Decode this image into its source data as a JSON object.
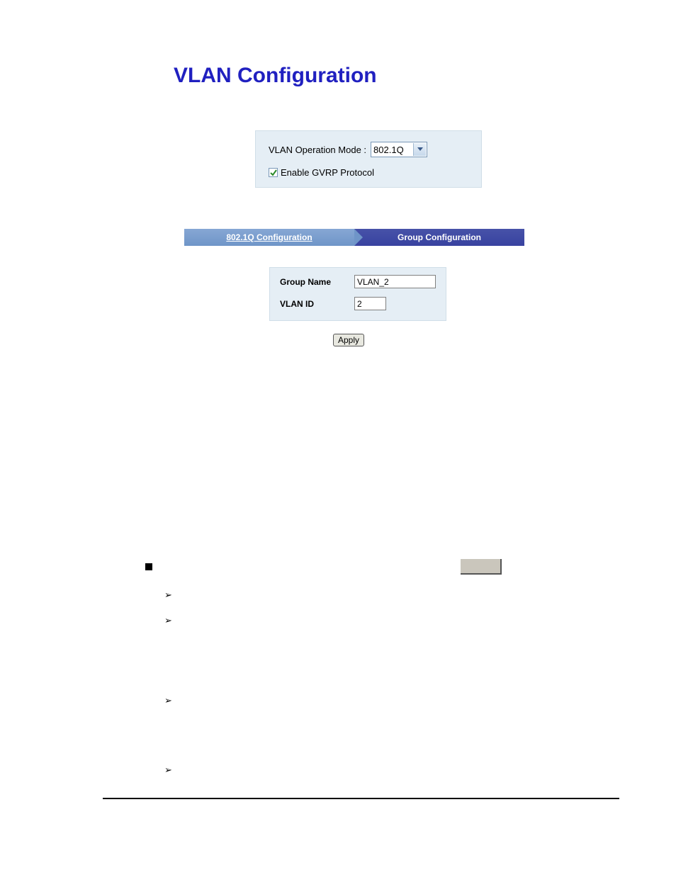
{
  "title": "VLAN Configuration",
  "mode_panel": {
    "label": "VLAN Operation Mode :",
    "selected": "802.1Q",
    "gvrp_label": "Enable GVRP Protocol",
    "gvrp_checked": true
  },
  "tabs": {
    "active": "802.1Q Configuration",
    "inactive": "Group Configuration"
  },
  "form": {
    "group_name_label": "Group Name",
    "group_name_value": "VLAN_2",
    "vlan_id_label": "VLAN ID",
    "vlan_id_value": "2"
  },
  "apply_label": "Apply",
  "arrows": [
    "➢",
    "➢",
    "➢",
    "➢"
  ]
}
